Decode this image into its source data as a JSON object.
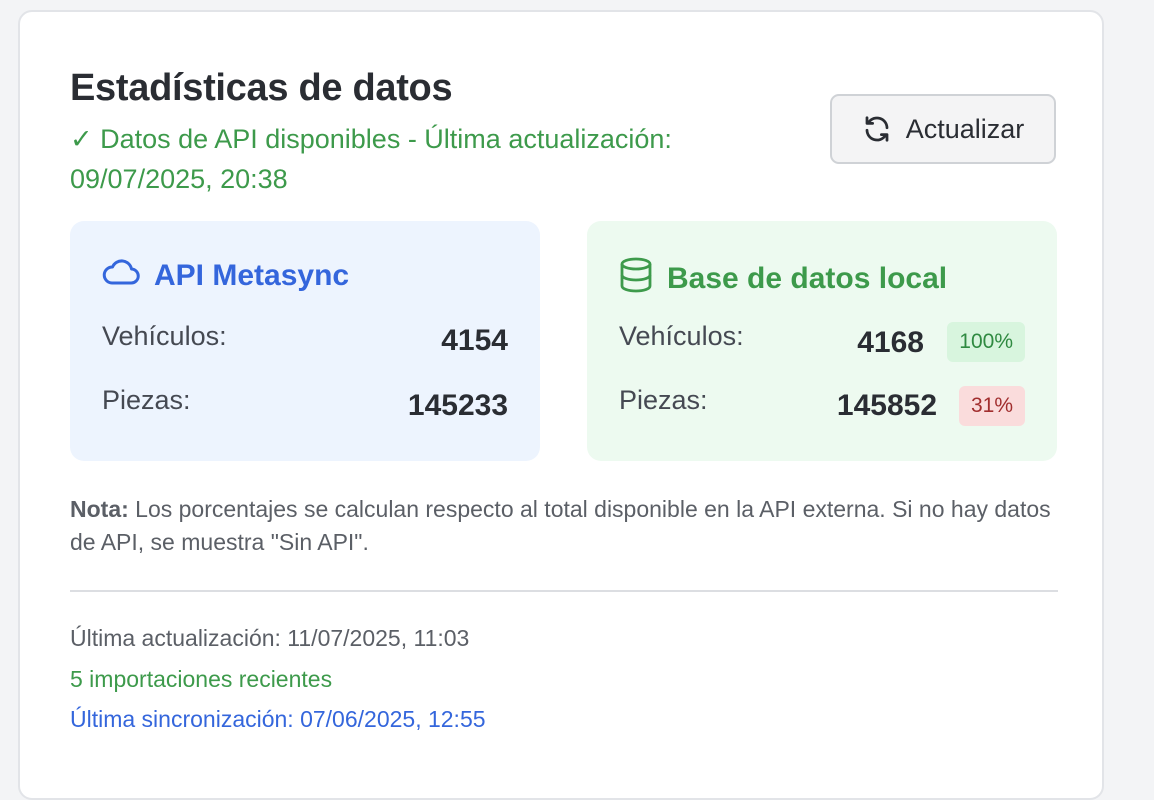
{
  "header": {
    "title": "Estadísticas de datos",
    "api_status": "✓ Datos de API disponibles - Última actualización: 09/07/2025, 20:38",
    "refresh_label": "Actualizar"
  },
  "api_panel": {
    "title": "API Metasync",
    "icon": "cloud-icon",
    "rows": [
      {
        "label": "Vehículos:",
        "value": "4154"
      },
      {
        "label": "Piezas:",
        "value": "145233"
      }
    ]
  },
  "local_panel": {
    "title": "Base de datos local",
    "icon": "database-icon",
    "rows": [
      {
        "label": "Vehículos:",
        "value": "4168",
        "badge": "100%"
      },
      {
        "label": "Piezas:",
        "value": "145852",
        "badge": "31%"
      }
    ]
  },
  "note": {
    "prefix": "Nota:",
    "text": " Los porcentajes se calculan respecto al total disponible en la API externa. Si no hay datos de API, se muestra \"Sin API\"."
  },
  "footer": {
    "last_update": "Última actualización: 11/07/2025, 11:03",
    "recent_imports": "5 importaciones recientes",
    "last_sync": "Última sincronización: 07/06/2025, 12:55"
  },
  "colors": {
    "api_accent": "#3466dc",
    "local_accent": "#3d9a4b",
    "badge_ok_bg": "#d8f5de",
    "badge_bad_bg": "#fadcdc"
  }
}
